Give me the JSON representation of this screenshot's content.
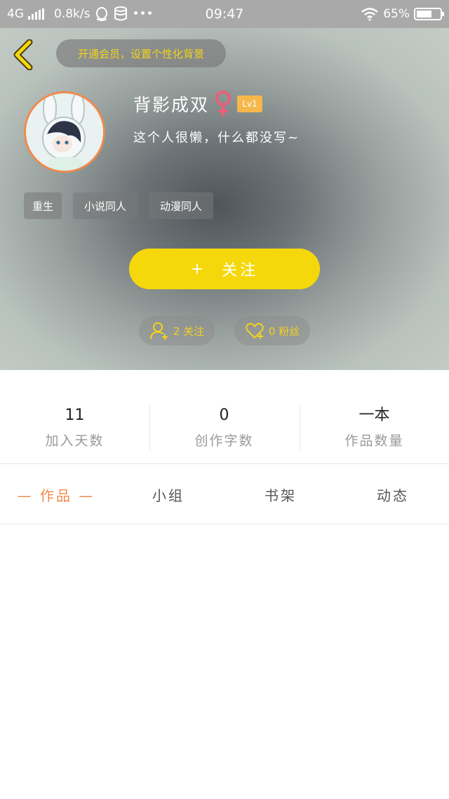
{
  "status_bar": {
    "network": "4G",
    "speed": "0.8k/s",
    "more": "•••",
    "time": "09:47",
    "battery_percent": "65%",
    "battery_level": 0.65
  },
  "profile": {
    "vip_banner": "开通会员，设置个性化背景",
    "username": "背影成双",
    "level": "Lv1",
    "bio": "这个人很懒，什么都没写~",
    "tags": [
      "重生",
      "小说同人",
      "动漫同人"
    ],
    "follow_label": "关注",
    "follow_plus": "+",
    "following_text": "2 关注",
    "fans_text": "0 粉丝"
  },
  "stats": [
    {
      "value": "11",
      "label": "加入天数"
    },
    {
      "value": "0",
      "label": "创作字数"
    },
    {
      "value": "一本",
      "label": "作品数量"
    }
  ],
  "tabs": [
    {
      "label": "— 作品 —",
      "active": true
    },
    {
      "label": "小组",
      "active": false
    },
    {
      "label": "书架",
      "active": false
    },
    {
      "label": "动态",
      "active": false
    }
  ],
  "colors": {
    "accent_orange": "#f08a4b",
    "follow_yellow": "#f5d80b",
    "banner_text": "#f2d31b",
    "female_pink": "#e8607a"
  }
}
